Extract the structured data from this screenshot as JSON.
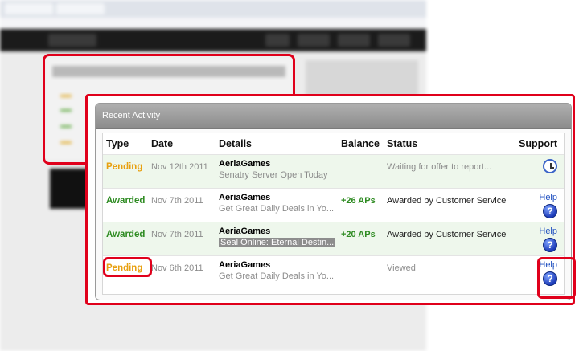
{
  "panel": {
    "title": "Recent Activity",
    "columns": {
      "type": "Type",
      "date": "Date",
      "details": "Details",
      "balance": "Balance",
      "status": "Status",
      "support": "Support"
    },
    "rows": [
      {
        "type": "Pending",
        "date": "Nov 12th 2011",
        "details_title": "AeriaGames",
        "details_sub": "Senatry Server Open Today",
        "balance": "",
        "status": "Waiting for offer to report...",
        "support_label": "",
        "support_icon": "clock-icon"
      },
      {
        "type": "Awarded",
        "date": "Nov 7th 2011",
        "details_title": "AeriaGames",
        "details_sub": "Get Great Daily Deals in Yo...",
        "balance": "+26 APs",
        "status": "Awarded by Customer Service",
        "support_label": "Help",
        "support_icon": "help-icon"
      },
      {
        "type": "Awarded",
        "date": "Nov 7th 2011",
        "details_title": "AeriaGames",
        "details_sub": "Seal Online: Eternal Destin...",
        "balance": "+20 APs",
        "status": "Awarded by Customer Service",
        "support_label": "Help",
        "support_icon": "help-icon"
      },
      {
        "type": "Pending",
        "date": "Nov 6th 2011",
        "details_title": "AeriaGames",
        "details_sub": "Get Great Daily Deals in Yo...",
        "balance": "",
        "status": "Viewed",
        "support_label": "Help",
        "support_icon": "help-icon"
      }
    ]
  },
  "colors": {
    "highlight": "#e0001b",
    "pending": "#e8a010",
    "awarded": "#2e8b22",
    "help": "#2050c0"
  }
}
